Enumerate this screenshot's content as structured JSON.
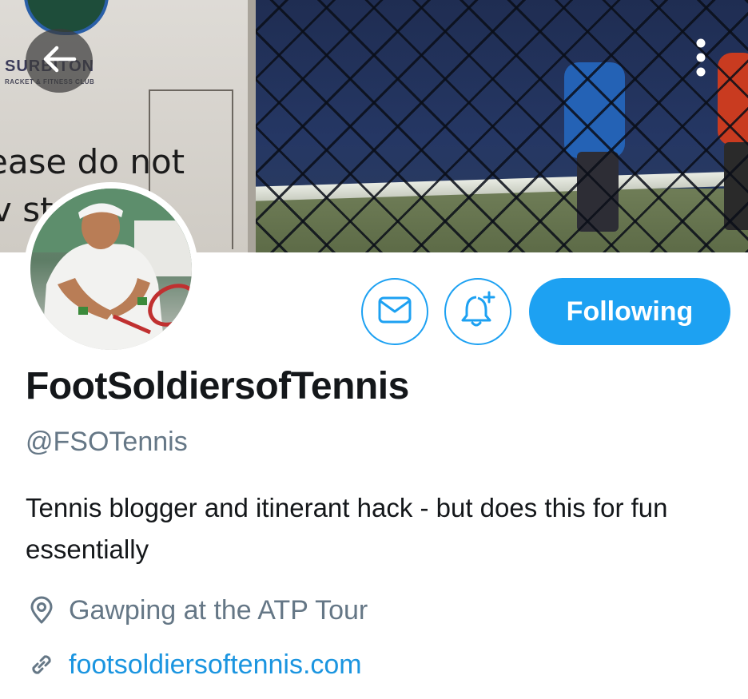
{
  "header": {
    "back_icon": "arrow-left-icon",
    "more_icon": "more-vertical-icon",
    "banner": {
      "sign_name": "SURBITON",
      "sign_sub": "RACKET & FITNESS CLUB",
      "sign_line1": "ease do not",
      "sign_line2": "v st       to"
    }
  },
  "actions": {
    "message_icon": "envelope-icon",
    "notify_icon": "bell-plus-icon",
    "follow_label": "Following"
  },
  "profile": {
    "display_name": "FootSoldiersofTennis",
    "handle": "@FSOTennis",
    "bio": "Tennis blogger and itinerant hack - but does this for fun essentially",
    "location": "Gawping at the ATP Tour",
    "location_icon": "location-pin-icon",
    "website": "footsoldiersoftennis.com",
    "website_icon": "link-icon"
  },
  "colors": {
    "accent": "#1da1f2",
    "link": "#1b95e0",
    "secondary_text": "#657786",
    "primary_text": "#14171a"
  }
}
